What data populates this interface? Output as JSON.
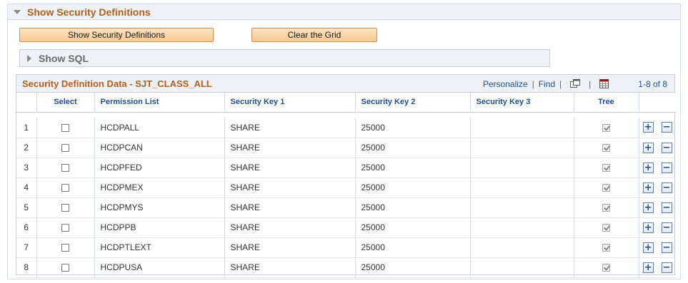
{
  "section": {
    "title": "Show Security Definitions"
  },
  "buttons": {
    "show_security": "Show Security Definitions",
    "clear_grid": "Clear the Grid"
  },
  "sql": {
    "title": "Show SQL"
  },
  "grid": {
    "title": "Security Definition Data - SJT_CLASS_ALL",
    "personalize": "Personalize",
    "separator": "|",
    "find": "Find",
    "count": "1-8 of 8",
    "columns": {
      "select": "Select",
      "permission_list": "Permission List",
      "key1": "Security Key 1",
      "key2": "Security Key 2",
      "key3": "Security Key 3",
      "tree": "Tree"
    },
    "rows": [
      {
        "num": "1",
        "perm": "HCDPALL",
        "key1": "SHARE",
        "key2": "25000",
        "key3": "",
        "tree": true
      },
      {
        "num": "2",
        "perm": "HCDPCAN",
        "key1": "SHARE",
        "key2": "25000",
        "key3": "",
        "tree": true
      },
      {
        "num": "3",
        "perm": "HCDPFED",
        "key1": "SHARE",
        "key2": "25000",
        "key3": "",
        "tree": true
      },
      {
        "num": "4",
        "perm": "HCDPMEX",
        "key1": "SHARE",
        "key2": "25000",
        "key3": "",
        "tree": true
      },
      {
        "num": "5",
        "perm": "HCDPMYS",
        "key1": "SHARE",
        "key2": "25000",
        "key3": "",
        "tree": true
      },
      {
        "num": "6",
        "perm": "HCDPPB",
        "key1": "SHARE",
        "key2": "25000",
        "key3": "",
        "tree": true
      },
      {
        "num": "7",
        "perm": "HCDPTLEXT",
        "key1": "SHARE",
        "key2": "25000",
        "key3": "",
        "tree": true
      },
      {
        "num": "8",
        "perm": "HCDPUSA",
        "key1": "SHARE",
        "key2": "25000",
        "key3": "",
        "tree": true
      }
    ],
    "add_symbol": "+",
    "delete_symbol": "−"
  },
  "icons": {
    "section_toggle": "triangle-down-icon",
    "sql_toggle": "triangle-right-icon",
    "view_all": "new-window-icon",
    "download": "spreadsheet-download-icon"
  },
  "colors": {
    "section_title": "#b05f1d",
    "link": "#1f4e8c",
    "button_bg": "#f6c98e",
    "header_bg": "#eef1f5"
  }
}
